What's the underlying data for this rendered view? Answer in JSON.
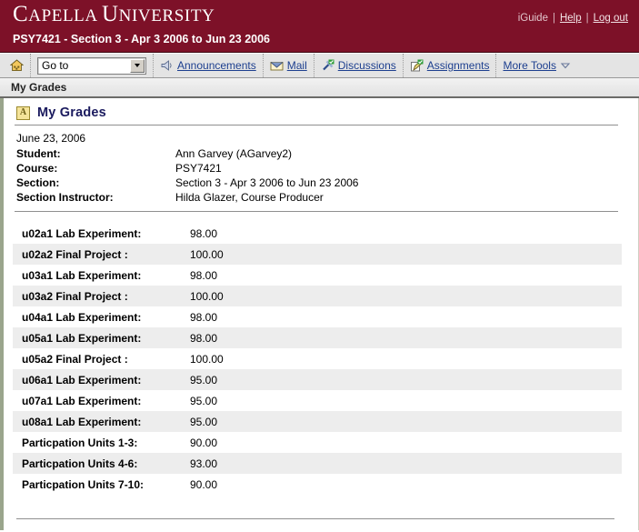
{
  "header": {
    "brand_first": "C",
    "brand_rest1": "APELLA ",
    "brand_second": "U",
    "brand_rest2": "NIVERSITY",
    "brand_full": "Capella University",
    "iguide": "iGuide",
    "help": "Help",
    "logout": "Log out",
    "separator": "|",
    "course_line": "PSY7421 - Section 3 - Apr 3 2006 to Jun 23 2006",
    "bg_color": "#7d1128"
  },
  "nav": {
    "home_icon": "home-icon",
    "goto_value": "Go to",
    "items": [
      {
        "label": "Announcements",
        "icon": "announcements-icon"
      },
      {
        "label": "Mail",
        "icon": "mail-envelope-icon"
      },
      {
        "label": "Discussions",
        "icon": "discussions-pushpin-icon"
      },
      {
        "label": "Assignments",
        "icon": "assignments-page-icon"
      },
      {
        "label": "More Tools",
        "icon": "chevron-down-icon"
      }
    ]
  },
  "breadcrumb": {
    "label": "My Grades"
  },
  "page": {
    "title": "My Grades",
    "title_icon": "grade-letter-a-icon",
    "date": "June 23, 2006"
  },
  "info": {
    "rows": [
      {
        "key": "Student:",
        "value": "Ann Garvey (AGarvey2)"
      },
      {
        "key": "Course:",
        "value": "PSY7421"
      },
      {
        "key": "Section:",
        "value": "Section 3 - Apr 3 2006 to Jun 23 2006"
      },
      {
        "key": "Section Instructor:",
        "value": "Hilda Glazer, Course Producer"
      }
    ]
  },
  "grades": {
    "rows": [
      {
        "name": "u02a1 Lab Experiment:",
        "score": "98.00"
      },
      {
        "name": "u02a2 Final Project :",
        "score": "100.00"
      },
      {
        "name": "u03a1 Lab Experiment:",
        "score": "98.00"
      },
      {
        "name": "u03a2 Final Project :",
        "score": "100.00"
      },
      {
        "name": "u04a1 Lab Experiment:",
        "score": "98.00"
      },
      {
        "name": "u05a1 Lab Experiment:",
        "score": "98.00"
      },
      {
        "name": "u05a2 Final Project :",
        "score": "100.00"
      },
      {
        "name": "u06a1 Lab Experiment:",
        "score": "95.00"
      },
      {
        "name": "u07a1 Lab Experiment:",
        "score": "95.00"
      },
      {
        "name": "u08a1 Lab Experiment:",
        "score": "95.00"
      },
      {
        "name": "Particpation Units 1-3:",
        "score": "90.00"
      },
      {
        "name": "Particpation Units 4-6:",
        "score": "93.00"
      },
      {
        "name": "Particpation Units 7-10:",
        "score": "90.00"
      }
    ]
  }
}
